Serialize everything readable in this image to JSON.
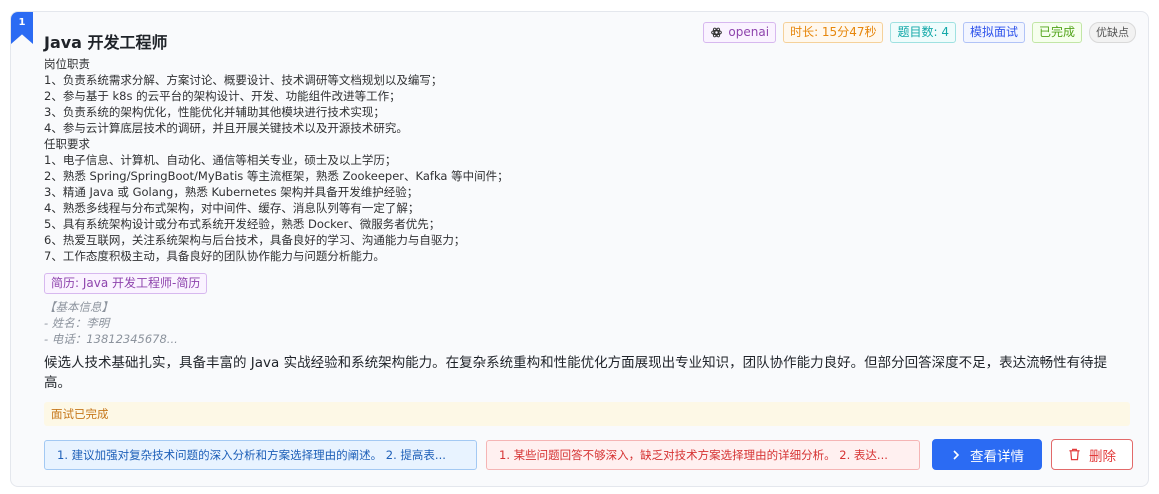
{
  "card": {
    "index": "1",
    "title": "Java 开发工程师",
    "tags": {
      "model": "openai",
      "duration": "时长: 15分47秒",
      "question_count": "题目数: 4",
      "mode": "模拟面试",
      "status": "已完成",
      "strengths": "优缺点"
    },
    "job_description": "岗位职责\n1、负责系统需求分解、方案讨论、概要设计、技术调研等文档规划以及编写；\n2、参与基于 k8s 的云平台的架构设计、开发、功能组件改进等工作；\n3、负责系统的架构优化，性能优化并辅助其他模块进行技术实现；\n4、参与云计算底层技术的调研，并且开展关键技术以及开源技术研究。\n任职要求\n1、电子信息、计算机、自动化、通信等相关专业，硕士及以上学历；\n2、熟悉 Spring/SpringBoot/MyBatis 等主流框架，熟悉 Zookeeper、Kafka 等中间件；\n3、精通 Java 或 Golang，熟悉 Kubernetes 架构并具备开发维护经验；\n4、熟悉多线程与分布式架构，对中间件、缓存、消息队列等有一定了解；\n5、具有系统架构设计或分布式系统开发经验，熟悉 Docker、微服务者优先；\n6、热爱互联网，关注系统架构与后台技术，具备良好的学习、沟通能力与自驱力；\n7、工作态度积极主动，具备良好的团队协作能力与问题分析能力。",
    "resume_tag": "简历: Java 开发工程师-简历",
    "resume_preview": "【基本信息】\n- 姓名：李明\n- 电话：13812345678...",
    "summary": "候选人技术基础扎实，具备丰富的 Java 实战经验和系统架构能力。在复杂系统重构和性能优化方面展现出专业知识，团队协作能力良好。但部分回答深度不足，表达流畅性有待提高。",
    "status_message": "面试已完成",
    "suggestions": "1. 建议加强对复杂技术问题的深入分析和方案选择理由的阐述。 2. 提高表...",
    "weaknesses": "1. 某些问题回答不够深入，缺乏对技术方案选择理由的详细分析。 2. 表达...",
    "view_details_label": "查看详情",
    "delete_label": "删除"
  },
  "icons": {
    "model": "openai-logo-icon",
    "view": "chevron-right-icon",
    "delete": "trash-icon"
  },
  "colors": {
    "primary": "#2b6bf3",
    "danger": "#e23b3b",
    "status_bg": "#fdf8e6"
  }
}
